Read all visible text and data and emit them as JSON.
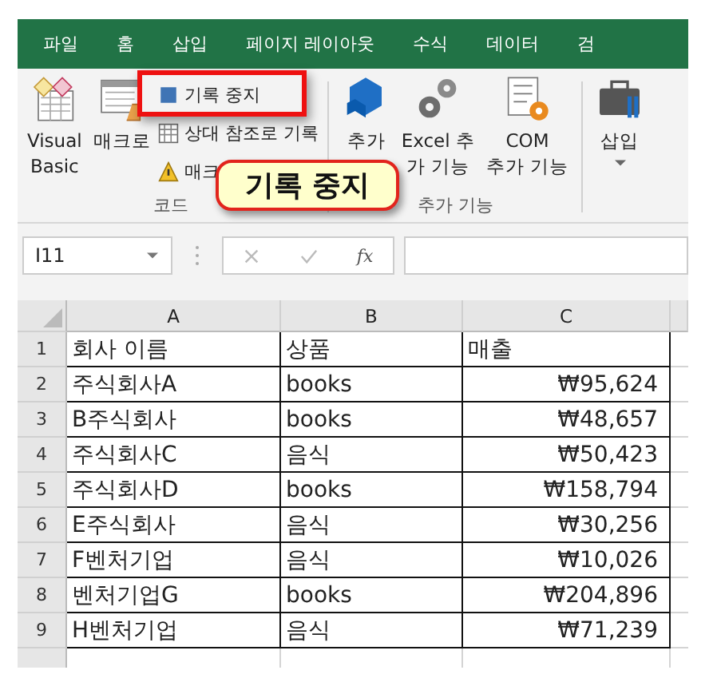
{
  "ribbon_tabs": [
    {
      "label": "파일",
      "selected": false
    },
    {
      "label": "홈",
      "selected": false
    },
    {
      "label": "삽입",
      "selected": false
    },
    {
      "label": "페이지 레이아웃",
      "selected": false
    },
    {
      "label": "수식",
      "selected": false
    },
    {
      "label": "데이터",
      "selected": false
    },
    {
      "label": "검",
      "selected": false
    }
  ],
  "ribbon_groups": [
    {
      "label": "코드",
      "buttons": [
        {
          "kind": "large",
          "lines": [
            "Visual",
            "Basic"
          ]
        },
        {
          "kind": "large",
          "lines": [
            "매크로"
          ]
        },
        {
          "kind": "small",
          "label": "기록 중지"
        },
        {
          "kind": "small",
          "label": "상대 참조로 기록"
        },
        {
          "kind": "small",
          "label": "매크"
        }
      ]
    },
    {
      "label": "추가 기능",
      "buttons": [
        {
          "kind": "large",
          "lines": [
            "추가"
          ]
        },
        {
          "kind": "large",
          "lines": [
            "Excel 추",
            "가 기능"
          ]
        },
        {
          "kind": "large",
          "lines": [
            "COM",
            "추가 기능"
          ]
        }
      ]
    },
    {
      "buttons": [
        {
          "kind": "dropdown",
          "lines": [
            "삽입"
          ]
        }
      ]
    }
  ],
  "callout": {
    "text": "기록 중지"
  },
  "formula_bar": {
    "name_box": "I11",
    "fx": "fx"
  },
  "sheet": {
    "columns": [
      "A",
      "B",
      "C"
    ],
    "rows": [
      {
        "header": "1",
        "cells": [
          "회사 이름",
          "상품",
          "매출"
        ]
      },
      {
        "header": "2",
        "cells": [
          "주식회사A",
          "books",
          "₩95,624"
        ]
      },
      {
        "header": "3",
        "cells": [
          "B주식회사",
          "books",
          "₩48,657"
        ]
      },
      {
        "header": "4",
        "cells": [
          "주식회사C",
          "음식",
          "₩50,423"
        ]
      },
      {
        "header": "5",
        "cells": [
          "주식회사D",
          "books",
          "₩158,794"
        ]
      },
      {
        "header": "6",
        "cells": [
          "E주식회사",
          "음식",
          "₩30,256"
        ]
      },
      {
        "header": "7",
        "cells": [
          "F벤처기업",
          "음식",
          "₩10,026"
        ]
      },
      {
        "header": "8",
        "cells": [
          "벤처기업G",
          "books",
          "₩204,896"
        ]
      },
      {
        "header": "9",
        "cells": [
          "H벤처기업",
          "음식",
          "₩71,239"
        ]
      }
    ]
  }
}
